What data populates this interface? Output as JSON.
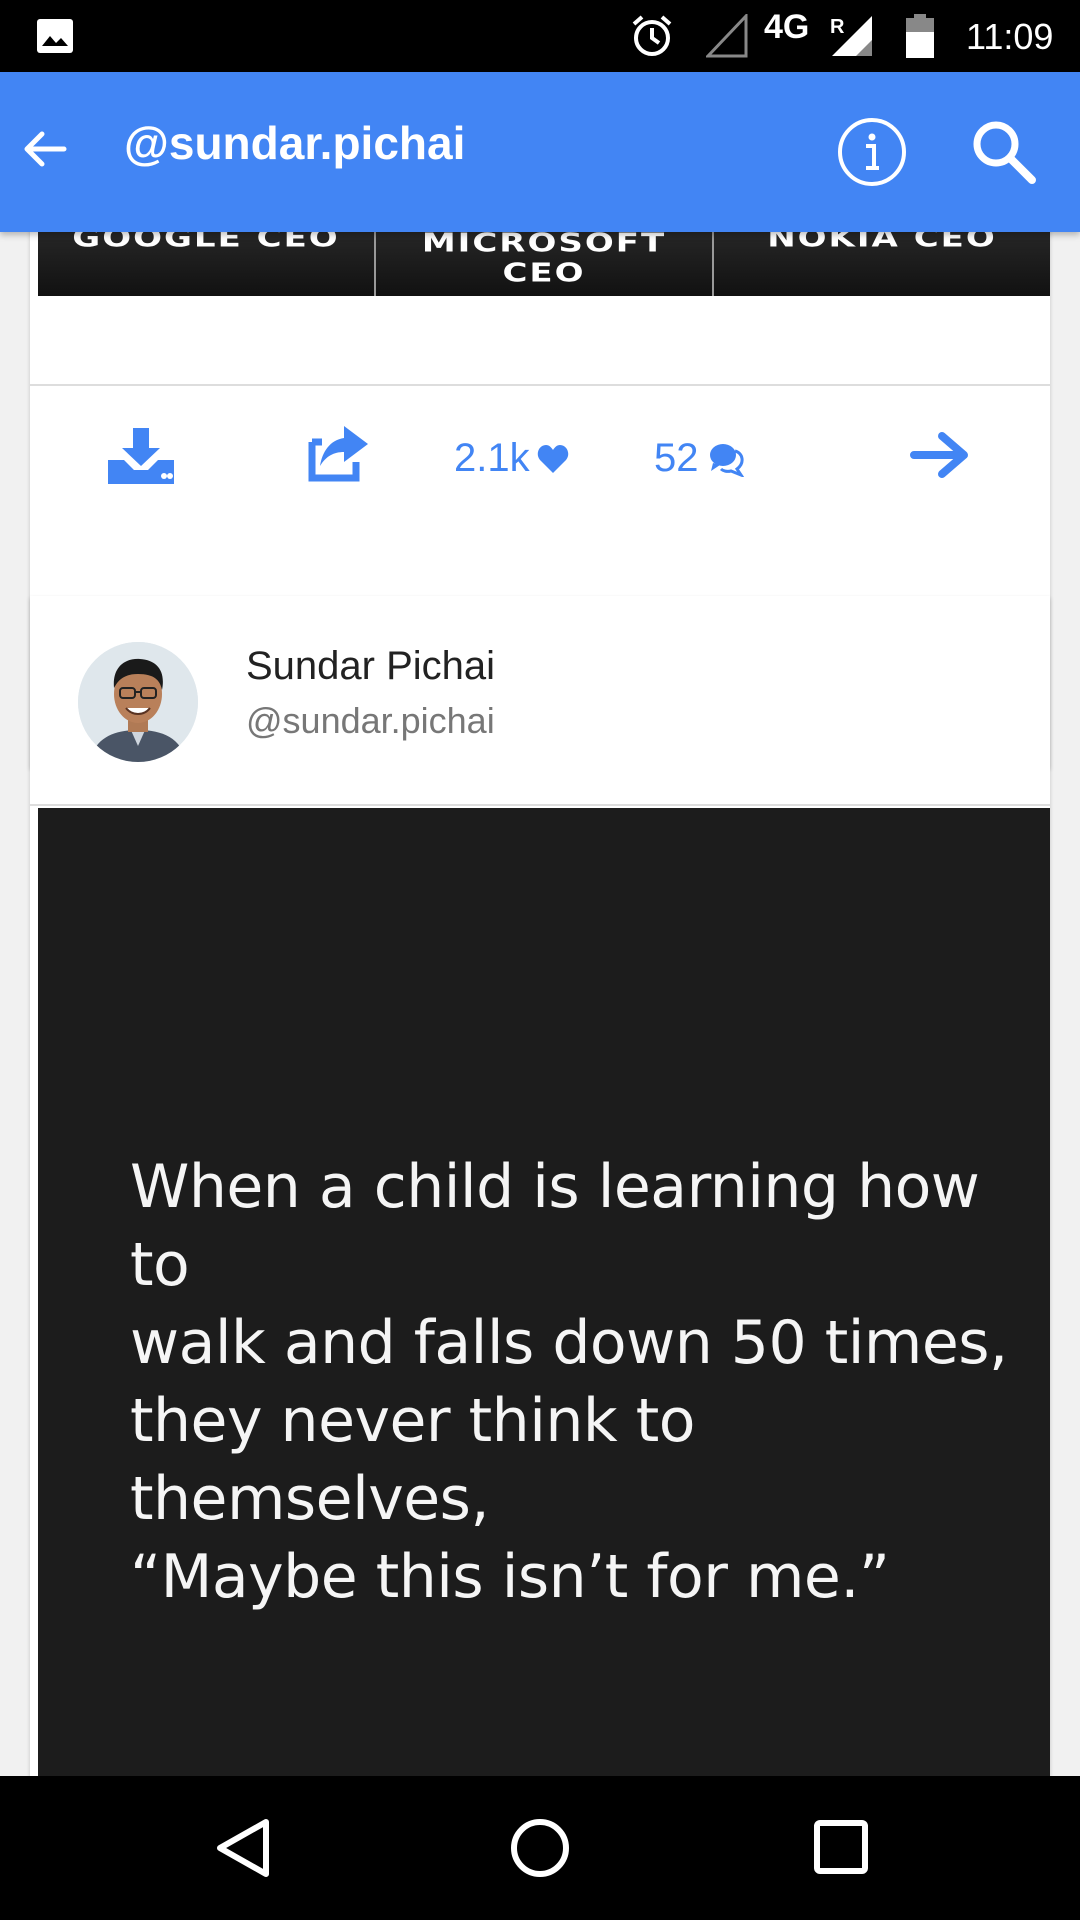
{
  "status_bar": {
    "network": "4G",
    "roaming": "R",
    "time": "11:09",
    "icons": [
      "gallery-icon",
      "alarm-icon",
      "signal-empty-icon",
      "signal-full-icon",
      "battery-icon"
    ]
  },
  "app_bar": {
    "title": "@sundar.pichai",
    "icons": [
      "back-arrow-icon",
      "info-icon",
      "search-icon"
    ],
    "color": "#4285f4"
  },
  "posts": [
    {
      "meme_captions": [
        "GOOGLE CEO",
        "MICROSOFT CEO",
        "NOKIA CEO"
      ],
      "actions": {
        "likes": "2.1k",
        "comments": "52"
      }
    },
    {
      "author_name": "Sundar Pichai",
      "author_handle": "@sundar.pichai",
      "quote_lines": [
        "When a child is learning how to",
        "walk and falls down 50 times,",
        "they never think to themselves,",
        "“Maybe this isn’t for me.”"
      ]
    }
  ],
  "nav_bar": {
    "icons": [
      "back-nav-icon",
      "home-icon",
      "recents-icon"
    ]
  },
  "accent_color": "#4285f4"
}
